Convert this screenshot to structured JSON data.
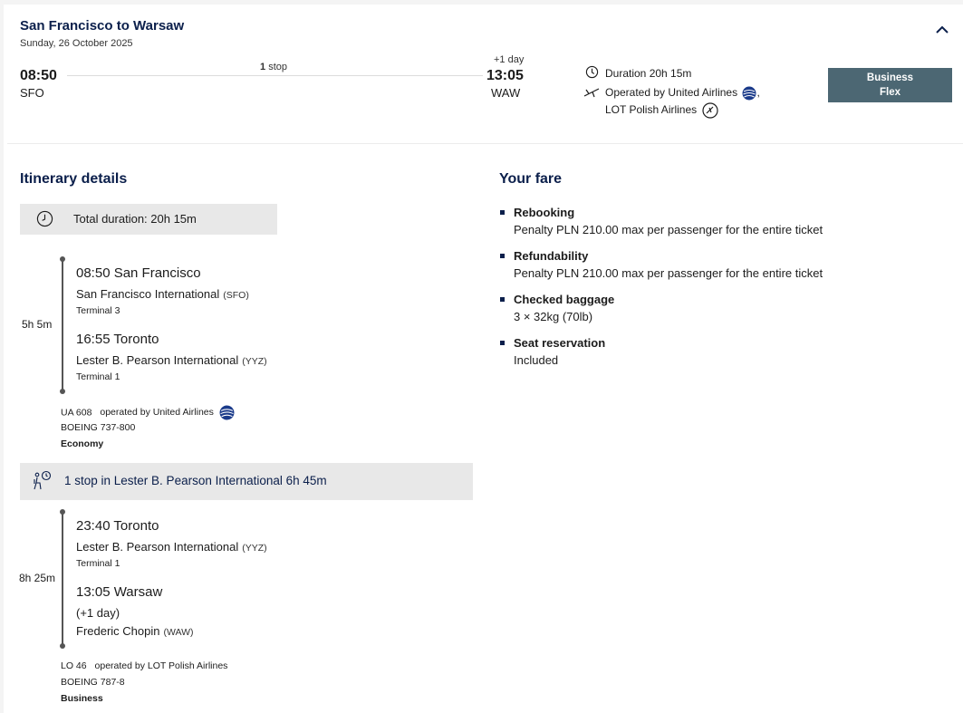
{
  "header": {
    "title": "San Francisco to Warsaw",
    "date": "Sunday, 26 October 2025",
    "depart_time": "08:50",
    "depart_code": "SFO",
    "stops_count": "1",
    "stops_label": "stop",
    "plus_day": "+1 day",
    "arrive_time": "13:05",
    "arrive_code": "WAW",
    "duration": "Duration 20h 15m",
    "operated_by_prefix": "Operated by United Airlines",
    "operated_by_comma": ",",
    "operated_by_second": "LOT Polish Airlines",
    "fare_badge_line1": "Business",
    "fare_badge_line2": "Flex"
  },
  "itinerary": {
    "heading": "Itinerary details",
    "total_duration": "Total duration: 20h 15m",
    "segments": [
      {
        "duration": "5h 5m",
        "dep_time_city": "08:50 San Francisco",
        "dep_airport": "San Francisco International",
        "dep_code": "(SFO)",
        "dep_terminal": "Terminal 3",
        "arr_time_city": "16:55 Toronto",
        "arr_airport": "Lester B. Pearson International",
        "arr_code": "(YYZ)",
        "arr_terminal": "Terminal 1",
        "flight": "UA 608",
        "operated": "operated by United Airlines",
        "aircraft": "BOEING 737-800",
        "cabin": "Economy"
      },
      {
        "duration": "8h 25m",
        "dep_time_city": "23:40 Toronto",
        "dep_airport": "Lester B. Pearson International",
        "dep_code": "(YYZ)",
        "dep_terminal": "Terminal 1",
        "arr_time_city": "13:05 Warsaw",
        "arr_plus": "(+1 day)",
        "arr_airport": "Frederic Chopin",
        "arr_code": "(WAW)",
        "flight": "LO 46",
        "operated": "operated by LOT Polish Airlines",
        "aircraft": "BOEING 787-8",
        "cabin": "Business"
      }
    ],
    "layover": "1 stop in Lester B. Pearson International 6h 45m"
  },
  "fare": {
    "heading": "Your fare",
    "items": [
      {
        "title": "Rebooking",
        "text": "Penalty PLN 210.00 max per passenger for the entire ticket"
      },
      {
        "title": "Refundability",
        "text": "Penalty PLN 210.00 max per passenger for the entire ticket"
      },
      {
        "title": "Checked baggage",
        "text": "3 × 32kg (70lb)"
      },
      {
        "title": "Seat reservation",
        "text": "Included"
      }
    ]
  },
  "colors": {
    "navy": "#0b1f4b",
    "badge_bg": "#4c6773",
    "panel_bg": "#e8e8e8",
    "united_blue": "#1a3a8a"
  },
  "icons": [
    "chevron-up-icon",
    "clock-icon",
    "plane-icon",
    "united-logo-icon",
    "lot-logo-icon",
    "layover-icon"
  ]
}
